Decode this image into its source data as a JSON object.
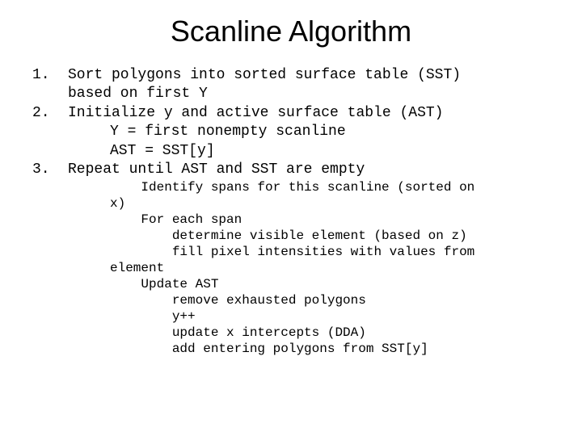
{
  "title": "Scanline Algorithm",
  "steps": [
    {
      "num": "1.",
      "text": "Sort polygons into sorted surface table (SST)\nbased on first Y"
    },
    {
      "num": "2.",
      "text": "Initialize y and active surface table (AST)",
      "sub": [
        "Y = first nonempty scanline",
        "AST = SST[y]"
      ]
    },
    {
      "num": "3.",
      "text": "Repeat until AST and SST are empty"
    }
  ],
  "detail": "    Identify spans for this scanline (sorted on\nx)\n    For each span\n        determine visible element (based on z)\n        fill pixel intensities with values from\nelement\n    Update AST\n        remove exhausted polygons\n        y++\n        update x intercepts (DDA)\n        add entering polygons from SST[y]"
}
